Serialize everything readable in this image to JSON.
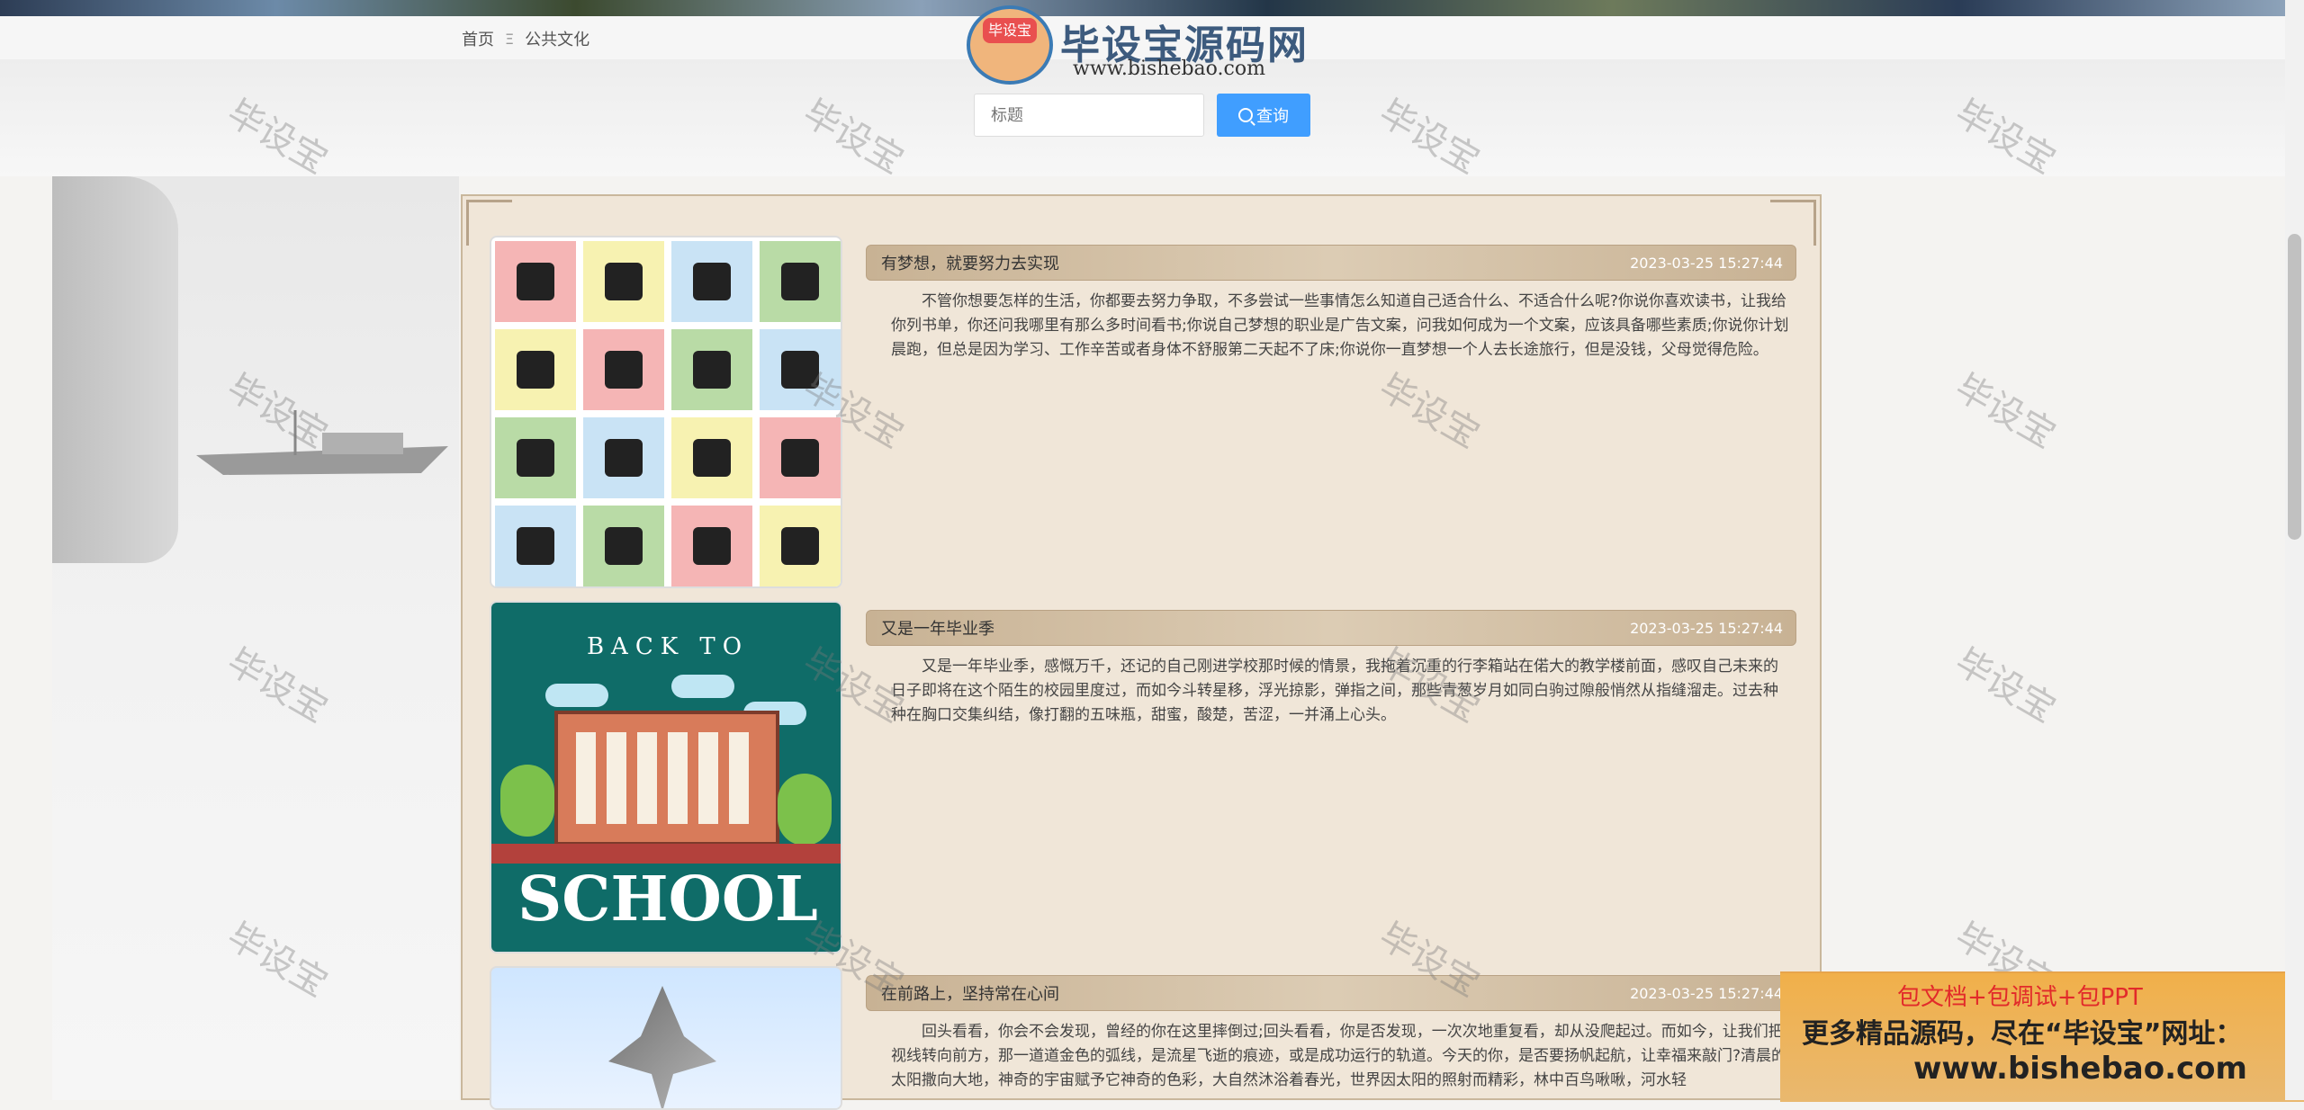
{
  "breadcrumb": {
    "home": "首页",
    "separator": "Ξ",
    "current": "公共文化"
  },
  "logo": {
    "badge": "毕设宝",
    "name": "毕设宝源码网",
    "url": "www.bishebao.com"
  },
  "search": {
    "placeholder": "标题",
    "button_label": "查询"
  },
  "articles": [
    {
      "title": "有梦想，就要努力去实现",
      "date": "2023-03-25 15:27:44",
      "body": "不管你想要怎样的生活，你都要去努力争取，不多尝试一些事情怎么知道自己适合什么、不适合什么呢?你说你喜欢读书，让我给你列书单，你还问我哪里有那么多时间看书;你说自己梦想的职业是广告文案，问我如何成为一个文案，应该具备哪些素质;你说你计划晨跑，但总是因为学习、工作辛苦或者身体不舒服第二天起不了床;你说你一直梦想一个人去长途旅行，但是没钱，父母觉得危险。"
    },
    {
      "title": "又是一年毕业季",
      "date": "2023-03-25 15:27:44",
      "body": "又是一年毕业季，感慨万千，还记的自己刚进学校那时候的情景，我拖着沉重的行李箱站在偌大的教学楼前面，感叹自己未来的日子即将在这个陌生的校园里度过，而如今斗转星移，浮光掠影，弹指之间，那些青葱岁月如同白驹过隙般悄然从指缝溜走。过去种种在胸口交集纠结，像打翻的五味瓶，甜蜜，酸楚，苦涩，一并涌上心头。",
      "poster_top": "BACK TO",
      "poster_word": "SCHOOL"
    },
    {
      "title": "在前路上，坚持常在心间",
      "date": "2023-03-25 15:27:44",
      "body": "回头看看，你会不会发现，曾经的你在这里摔倒过;回头看看，你是否发现，一次次地重复看，却从没爬起过。而如今，让我们把视线转向前方，那一道道金色的弧线，是流星飞逝的痕迹，或是成功运行的轨道。今天的你，是否要扬帆起航，让幸福来敲门?清晨的太阳撒向大地，神奇的宇宙赋予它神奇的色彩，大自然沐浴着春光，世界因太阳的照射而精彩，林中百鸟啾啾，河水轻"
    }
  ],
  "watermark_text": "毕设宝",
  "promo": {
    "line1": "包文档+包调试+包PPT",
    "line2": "更多精品源码，尽在“毕设宝”网址：",
    "line3": "www.bishebao.com"
  },
  "colors": {
    "accent": "#409eff",
    "panel": "#f0e6d8",
    "title_bar": "#c8b294",
    "promo": "#f1b04a"
  }
}
